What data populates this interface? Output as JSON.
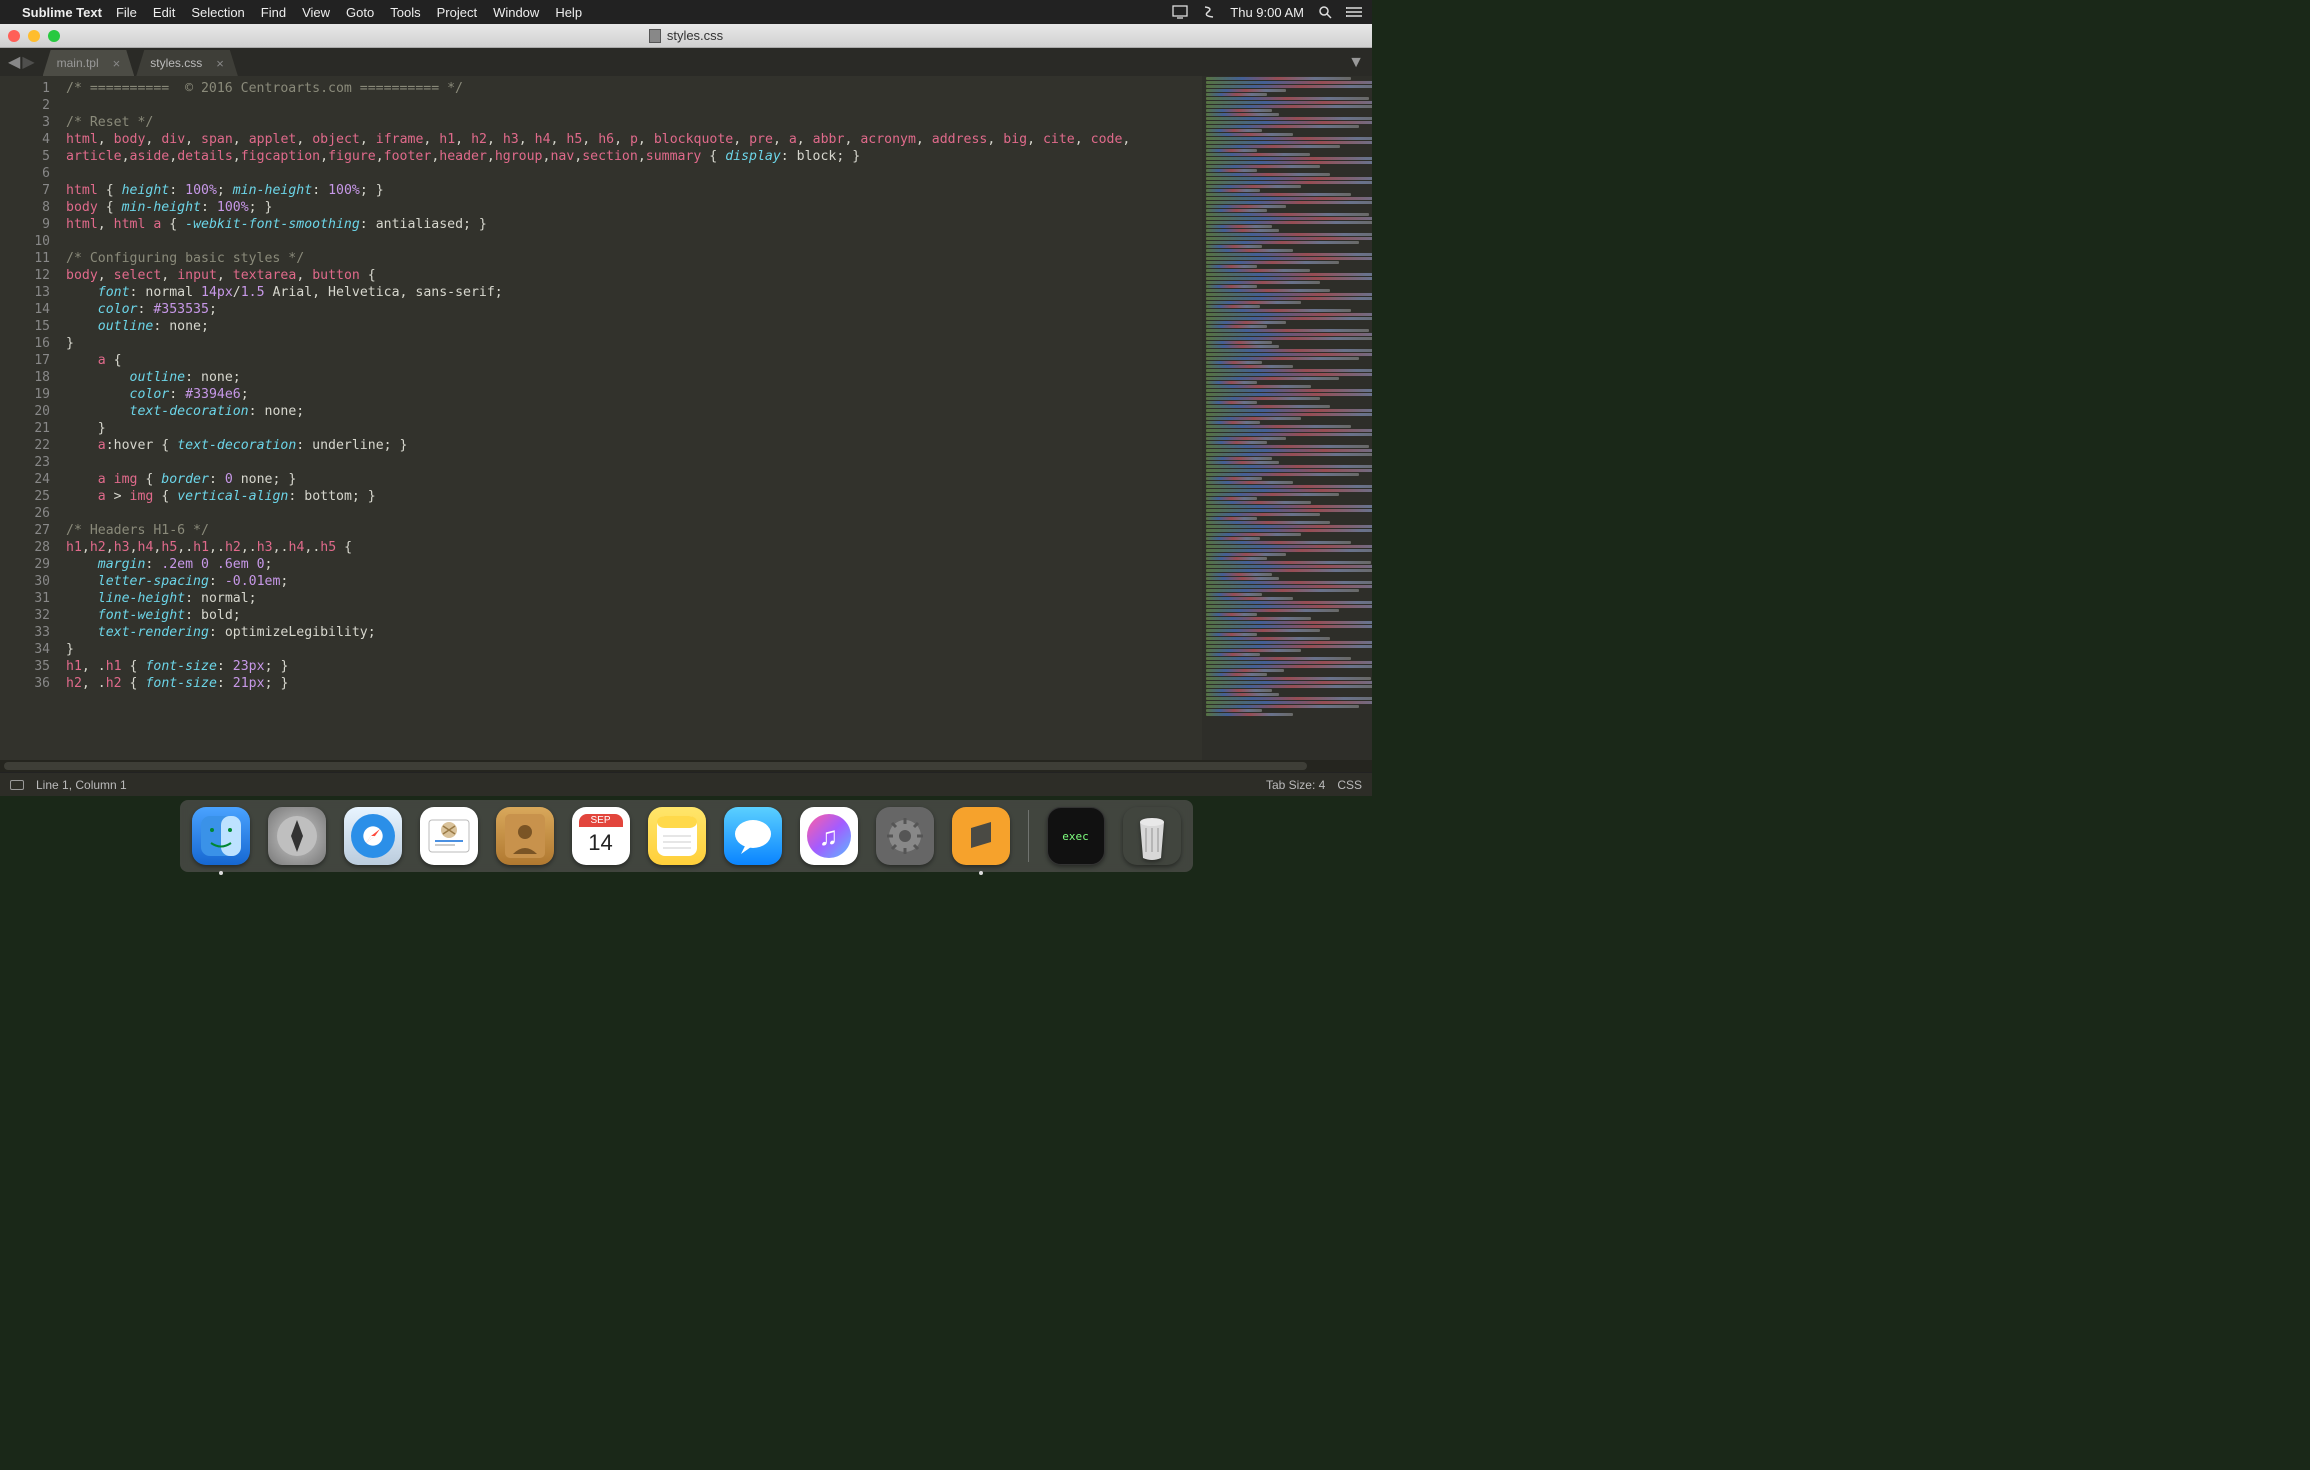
{
  "menubar": {
    "app": "Sublime Text",
    "items": [
      "File",
      "Edit",
      "Selection",
      "Find",
      "View",
      "Goto",
      "Tools",
      "Project",
      "Window",
      "Help"
    ],
    "clock": "Thu 9:00 AM"
  },
  "window": {
    "title": "styles.css"
  },
  "tabs": [
    {
      "label": "main.tpl",
      "active": false
    },
    {
      "label": "styles.css",
      "active": true
    }
  ],
  "statusbar": {
    "position": "Line 1, Column 1",
    "tabsize": "Tab Size: 4",
    "syntax": "CSS"
  },
  "dock": {
    "calendar": {
      "month": "SEP",
      "day": "14"
    },
    "terminal_label": "exec"
  },
  "code": {
    "lines": [
      {
        "n": 1,
        "seg": [
          [
            "c-comment",
            "/* ==========  © 2016 Centroarts.com ========== */"
          ]
        ]
      },
      {
        "n": 2,
        "seg": [
          [
            "",
            ""
          ]
        ]
      },
      {
        "n": 3,
        "seg": [
          [
            "c-comment",
            "/* Reset */"
          ]
        ]
      },
      {
        "n": 4,
        "seg": [
          [
            "c-sel",
            "html"
          ],
          [
            "c-punc",
            ", "
          ],
          [
            "c-sel",
            "body"
          ],
          [
            "c-punc",
            ", "
          ],
          [
            "c-sel",
            "div"
          ],
          [
            "c-punc",
            ", "
          ],
          [
            "c-sel",
            "span"
          ],
          [
            "c-punc",
            ", "
          ],
          [
            "c-sel",
            "applet"
          ],
          [
            "c-punc",
            ", "
          ],
          [
            "c-sel",
            "object"
          ],
          [
            "c-punc",
            ", "
          ],
          [
            "c-sel",
            "iframe"
          ],
          [
            "c-punc",
            ", "
          ],
          [
            "c-sel",
            "h1"
          ],
          [
            "c-punc",
            ", "
          ],
          [
            "c-sel",
            "h2"
          ],
          [
            "c-punc",
            ", "
          ],
          [
            "c-sel",
            "h3"
          ],
          [
            "c-punc",
            ", "
          ],
          [
            "c-sel",
            "h4"
          ],
          [
            "c-punc",
            ", "
          ],
          [
            "c-sel",
            "h5"
          ],
          [
            "c-punc",
            ", "
          ],
          [
            "c-sel",
            "h6"
          ],
          [
            "c-punc",
            ", "
          ],
          [
            "c-sel",
            "p"
          ],
          [
            "c-punc",
            ", "
          ],
          [
            "c-sel",
            "blockquote"
          ],
          [
            "c-punc",
            ", "
          ],
          [
            "c-sel",
            "pre"
          ],
          [
            "c-punc",
            ", "
          ],
          [
            "c-sel",
            "a"
          ],
          [
            "c-punc",
            ", "
          ],
          [
            "c-sel",
            "abbr"
          ],
          [
            "c-punc",
            ", "
          ],
          [
            "c-sel",
            "acronym"
          ],
          [
            "c-punc",
            ", "
          ],
          [
            "c-sel",
            "address"
          ],
          [
            "c-punc",
            ", "
          ],
          [
            "c-sel",
            "big"
          ],
          [
            "c-punc",
            ", "
          ],
          [
            "c-sel",
            "cite"
          ],
          [
            "c-punc",
            ", "
          ],
          [
            "c-sel",
            "code"
          ],
          [
            "c-punc",
            ", "
          ]
        ]
      },
      {
        "n": 5,
        "seg": [
          [
            "c-sel",
            "article"
          ],
          [
            "c-punc",
            ","
          ],
          [
            "c-sel",
            "aside"
          ],
          [
            "c-punc",
            ","
          ],
          [
            "c-sel",
            "details"
          ],
          [
            "c-punc",
            ","
          ],
          [
            "c-sel",
            "figcaption"
          ],
          [
            "c-punc",
            ","
          ],
          [
            "c-sel",
            "figure"
          ],
          [
            "c-punc",
            ","
          ],
          [
            "c-sel",
            "footer"
          ],
          [
            "c-punc",
            ","
          ],
          [
            "c-sel",
            "header"
          ],
          [
            "c-punc",
            ","
          ],
          [
            "c-sel",
            "hgroup"
          ],
          [
            "c-punc",
            ","
          ],
          [
            "c-sel",
            "nav"
          ],
          [
            "c-punc",
            ","
          ],
          [
            "c-sel",
            "section"
          ],
          [
            "c-punc",
            ","
          ],
          [
            "c-sel",
            "summary "
          ],
          [
            "c-punc",
            "{ "
          ],
          [
            "c-prop",
            "display"
          ],
          [
            "c-punc",
            ": "
          ],
          [
            "c-val",
            "block"
          ],
          [
            "c-punc",
            "; }"
          ]
        ]
      },
      {
        "n": 6,
        "seg": [
          [
            "",
            ""
          ]
        ]
      },
      {
        "n": 7,
        "seg": [
          [
            "c-sel",
            "html "
          ],
          [
            "c-punc",
            "{ "
          ],
          [
            "c-prop",
            "height"
          ],
          [
            "c-punc",
            ": "
          ],
          [
            "c-num",
            "100%"
          ],
          [
            "c-punc",
            "; "
          ],
          [
            "c-prop",
            "min-height"
          ],
          [
            "c-punc",
            ": "
          ],
          [
            "c-num",
            "100%"
          ],
          [
            "c-punc",
            "; }"
          ]
        ]
      },
      {
        "n": 8,
        "seg": [
          [
            "c-sel",
            "body "
          ],
          [
            "c-punc",
            "{ "
          ],
          [
            "c-prop",
            "min-height"
          ],
          [
            "c-punc",
            ": "
          ],
          [
            "c-num",
            "100%"
          ],
          [
            "c-punc",
            "; }"
          ]
        ]
      },
      {
        "n": 9,
        "seg": [
          [
            "c-sel",
            "html"
          ],
          [
            "c-punc",
            ", "
          ],
          [
            "c-sel",
            "html a "
          ],
          [
            "c-punc",
            "{ "
          ],
          [
            "c-prop",
            "-webkit-font-smoothing"
          ],
          [
            "c-punc",
            ": "
          ],
          [
            "c-val",
            "antialiased"
          ],
          [
            "c-punc",
            "; }"
          ]
        ]
      },
      {
        "n": 10,
        "seg": [
          [
            "",
            ""
          ]
        ]
      },
      {
        "n": 11,
        "seg": [
          [
            "c-comment",
            "/* Configuring basic styles */"
          ]
        ]
      },
      {
        "n": 12,
        "seg": [
          [
            "c-sel",
            "body"
          ],
          [
            "c-punc",
            ", "
          ],
          [
            "c-sel",
            "select"
          ],
          [
            "c-punc",
            ", "
          ],
          [
            "c-sel",
            "input"
          ],
          [
            "c-punc",
            ", "
          ],
          [
            "c-sel",
            "textarea"
          ],
          [
            "c-punc",
            ", "
          ],
          [
            "c-sel",
            "button "
          ],
          [
            "c-punc",
            "{"
          ]
        ]
      },
      {
        "n": 13,
        "seg": [
          [
            "",
            "    "
          ],
          [
            "c-prop",
            "font"
          ],
          [
            "c-punc",
            ": "
          ],
          [
            "c-val",
            "normal "
          ],
          [
            "c-num",
            "14px"
          ],
          [
            "c-punc",
            "/"
          ],
          [
            "c-num",
            "1.5 "
          ],
          [
            "c-val",
            "Arial, Helvetica, sans-serif"
          ],
          [
            "c-punc",
            ";"
          ]
        ]
      },
      {
        "n": 14,
        "seg": [
          [
            "",
            "    "
          ],
          [
            "c-prop",
            "color"
          ],
          [
            "c-punc",
            ": "
          ],
          [
            "c-hex",
            "#353535"
          ],
          [
            "c-punc",
            ";"
          ]
        ]
      },
      {
        "n": 15,
        "seg": [
          [
            "",
            "    "
          ],
          [
            "c-prop",
            "outline"
          ],
          [
            "c-punc",
            ": "
          ],
          [
            "c-val",
            "none"
          ],
          [
            "c-punc",
            ";"
          ]
        ]
      },
      {
        "n": 16,
        "seg": [
          [
            "c-punc",
            "}"
          ]
        ]
      },
      {
        "n": 17,
        "seg": [
          [
            "",
            "    "
          ],
          [
            "c-sel",
            "a "
          ],
          [
            "c-punc",
            "{"
          ]
        ]
      },
      {
        "n": 18,
        "seg": [
          [
            "",
            "        "
          ],
          [
            "c-prop",
            "outline"
          ],
          [
            "c-punc",
            ": "
          ],
          [
            "c-val",
            "none"
          ],
          [
            "c-punc",
            ";"
          ]
        ]
      },
      {
        "n": 19,
        "seg": [
          [
            "",
            "        "
          ],
          [
            "c-prop",
            "color"
          ],
          [
            "c-punc",
            ": "
          ],
          [
            "c-hex",
            "#3394e6"
          ],
          [
            "c-punc",
            ";"
          ]
        ]
      },
      {
        "n": 20,
        "seg": [
          [
            "",
            "        "
          ],
          [
            "c-prop",
            "text-decoration"
          ],
          [
            "c-punc",
            ": "
          ],
          [
            "c-val",
            "none"
          ],
          [
            "c-punc",
            ";"
          ]
        ]
      },
      {
        "n": 21,
        "seg": [
          [
            "",
            "    "
          ],
          [
            "c-punc",
            "}"
          ]
        ]
      },
      {
        "n": 22,
        "seg": [
          [
            "",
            "    "
          ],
          [
            "c-sel",
            "a"
          ],
          [
            "c-pseudo",
            ":hover "
          ],
          [
            "c-punc",
            "{ "
          ],
          [
            "c-prop",
            "text-decoration"
          ],
          [
            "c-punc",
            ": "
          ],
          [
            "c-val",
            "underline"
          ],
          [
            "c-punc",
            "; }"
          ]
        ]
      },
      {
        "n": 23,
        "seg": [
          [
            "",
            ""
          ]
        ]
      },
      {
        "n": 24,
        "seg": [
          [
            "",
            "    "
          ],
          [
            "c-sel",
            "a img "
          ],
          [
            "c-punc",
            "{ "
          ],
          [
            "c-prop",
            "border"
          ],
          [
            "c-punc",
            ": "
          ],
          [
            "c-num",
            "0 "
          ],
          [
            "c-val",
            "none"
          ],
          [
            "c-punc",
            "; }"
          ]
        ]
      },
      {
        "n": 25,
        "seg": [
          [
            "",
            "    "
          ],
          [
            "c-sel",
            "a "
          ],
          [
            "c-punc",
            "> "
          ],
          [
            "c-sel",
            "img "
          ],
          [
            "c-punc",
            "{ "
          ],
          [
            "c-prop",
            "vertical-align"
          ],
          [
            "c-punc",
            ": "
          ],
          [
            "c-val",
            "bottom"
          ],
          [
            "c-punc",
            "; }"
          ]
        ]
      },
      {
        "n": 26,
        "seg": [
          [
            "",
            ""
          ]
        ]
      },
      {
        "n": 27,
        "seg": [
          [
            "c-comment",
            "/* Headers H1-6 */"
          ]
        ]
      },
      {
        "n": 28,
        "seg": [
          [
            "c-sel",
            "h1"
          ],
          [
            "c-punc",
            ","
          ],
          [
            "c-sel",
            "h2"
          ],
          [
            "c-punc",
            ","
          ],
          [
            "c-sel",
            "h3"
          ],
          [
            "c-punc",
            ","
          ],
          [
            "c-sel",
            "h4"
          ],
          [
            "c-punc",
            ","
          ],
          [
            "c-sel",
            "h5"
          ],
          [
            "c-punc",
            ",."
          ],
          [
            "c-sel",
            "h1"
          ],
          [
            "c-punc",
            ",."
          ],
          [
            "c-sel",
            "h2"
          ],
          [
            "c-punc",
            ",."
          ],
          [
            "c-sel",
            "h3"
          ],
          [
            "c-punc",
            ",."
          ],
          [
            "c-sel",
            "h4"
          ],
          [
            "c-punc",
            ",."
          ],
          [
            "c-sel",
            "h5 "
          ],
          [
            "c-punc",
            "{"
          ]
        ]
      },
      {
        "n": 29,
        "seg": [
          [
            "",
            "    "
          ],
          [
            "c-prop",
            "margin"
          ],
          [
            "c-punc",
            ": "
          ],
          [
            "c-num",
            ".2em 0 .6em 0"
          ],
          [
            "c-punc",
            ";"
          ]
        ]
      },
      {
        "n": 30,
        "seg": [
          [
            "",
            "    "
          ],
          [
            "c-prop",
            "letter-spacing"
          ],
          [
            "c-punc",
            ": "
          ],
          [
            "c-num",
            "-0.01em"
          ],
          [
            "c-punc",
            ";"
          ]
        ]
      },
      {
        "n": 31,
        "seg": [
          [
            "",
            "    "
          ],
          [
            "c-prop",
            "line-height"
          ],
          [
            "c-punc",
            ": "
          ],
          [
            "c-val",
            "normal"
          ],
          [
            "c-punc",
            ";"
          ]
        ]
      },
      {
        "n": 32,
        "seg": [
          [
            "",
            "    "
          ],
          [
            "c-prop",
            "font-weight"
          ],
          [
            "c-punc",
            ": "
          ],
          [
            "c-val",
            "bold"
          ],
          [
            "c-punc",
            ";"
          ]
        ]
      },
      {
        "n": 33,
        "seg": [
          [
            "",
            "    "
          ],
          [
            "c-prop",
            "text-rendering"
          ],
          [
            "c-punc",
            ": "
          ],
          [
            "c-val",
            "optimizeLegibility"
          ],
          [
            "c-punc",
            ";"
          ]
        ]
      },
      {
        "n": 34,
        "seg": [
          [
            "c-punc",
            "}"
          ]
        ]
      },
      {
        "n": 35,
        "seg": [
          [
            "c-sel",
            "h1"
          ],
          [
            "c-punc",
            ", ."
          ],
          [
            "c-sel",
            "h1 "
          ],
          [
            "c-punc",
            "{ "
          ],
          [
            "c-prop",
            "font-size"
          ],
          [
            "c-punc",
            ": "
          ],
          [
            "c-num",
            "23px"
          ],
          [
            "c-punc",
            "; }"
          ]
        ]
      },
      {
        "n": 36,
        "seg": [
          [
            "c-sel",
            "h2"
          ],
          [
            "c-punc",
            ", ."
          ],
          [
            "c-sel",
            "h2 "
          ],
          [
            "c-punc",
            "{ "
          ],
          [
            "c-prop",
            "font-size"
          ],
          [
            "c-punc",
            ": "
          ],
          [
            "c-num",
            "21px"
          ],
          [
            "c-punc",
            "; }"
          ]
        ]
      }
    ]
  }
}
